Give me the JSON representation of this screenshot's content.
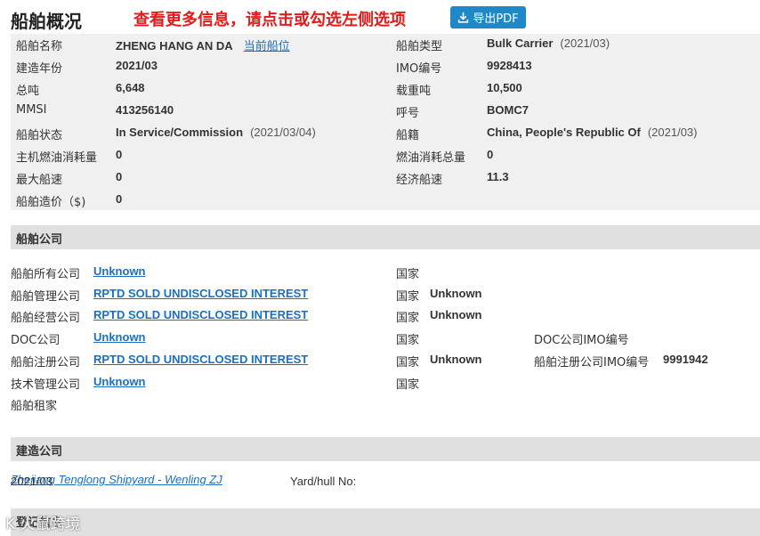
{
  "header": {
    "title": "船舶概况",
    "notice": "查看更多信息，请点击或勾选左侧选项",
    "pdf_button": "导出PDF"
  },
  "overview": {
    "rows": [
      [
        {
          "label": "船舶名称",
          "value": "ZHENG HANG AN DA",
          "link": "当前船位"
        },
        {
          "label": "船舶类型",
          "value": "Bulk Carrier",
          "sub": "(2021/03)"
        }
      ],
      [
        {
          "label": "建造年份",
          "value": "2021/03"
        },
        {
          "label": "IMO编号",
          "value": "9928413"
        }
      ],
      [
        {
          "label": "总吨",
          "value": "6,648"
        },
        {
          "label": "载重吨",
          "value": "10,500"
        }
      ],
      [
        {
          "label": "MMSI",
          "value": "413256140"
        },
        {
          "label": "呼号",
          "value": "BOMC7"
        }
      ],
      [
        {
          "label": "船舶状态",
          "value": "In Service/Commission",
          "sub": "(2021/03/04)"
        },
        {
          "label": "船籍",
          "value": "China, People's Republic Of",
          "sub": "(2021/03)"
        }
      ],
      [
        {
          "label": "主机燃油消耗量",
          "value": "0"
        },
        {
          "label": "燃油消耗总量",
          "value": "0"
        }
      ],
      [
        {
          "label": "最大船速",
          "value": "0"
        },
        {
          "label": "经济船速",
          "value": "11.3"
        }
      ],
      [
        {
          "label": "船舶造价（$)",
          "value": "0"
        },
        null
      ]
    ]
  },
  "company_section": {
    "title": "船舶公司",
    "rows": [
      {
        "label": "船舶所有公司",
        "link": "Unknown",
        "country_label": "国家",
        "country": ""
      },
      {
        "label": "船舶管理公司",
        "link": "RPTD SOLD UNDISCLOSED INTEREST",
        "country_label": "国家",
        "country": "Unknown"
      },
      {
        "label": "船舶经营公司",
        "link": "RPTD SOLD UNDISCLOSED INTEREST",
        "country_label": "国家",
        "country": "Unknown"
      },
      {
        "label": "DOC公司",
        "link": "Unknown",
        "country_label": "国家",
        "country": "",
        "imo_label": "DOC公司IMO编号",
        "imo": ""
      },
      {
        "label": "船舶注册公司",
        "link": "RPTD SOLD UNDISCLOSED INTEREST",
        "country_label": "国家",
        "country": "Unknown",
        "imo_label": "船舶注册公司IMO编号",
        "imo": "9991942"
      },
      {
        "label": "技术管理公司",
        "link": "Unknown",
        "country_label": "国家",
        "country": ""
      },
      {
        "label": "船舶租家",
        "link": "",
        "country_label": "",
        "country": ""
      }
    ]
  },
  "builder_section": {
    "title": "建造公司",
    "date": "2021/03",
    "builder": "Zhejiang Tenglong Shipyard - Wenling ZJ",
    "hull_label": "Yard/hull No:"
  },
  "next_section": {
    "title": "登记信息"
  },
  "watermark": "K 火鼠跨境",
  "colors": {
    "link": "#1a6fc4",
    "notice": "#e21b1b",
    "button": "#1e88c8",
    "panel": "#f0f0f0",
    "section_bar": "#e0e0e0"
  }
}
